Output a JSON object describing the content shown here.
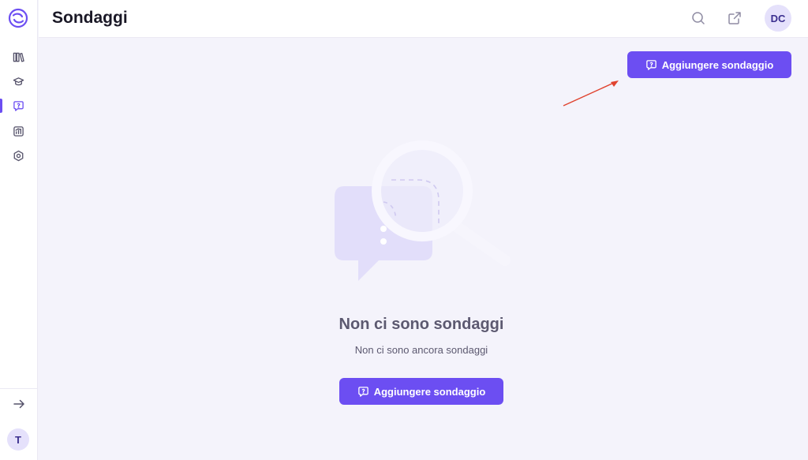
{
  "header": {
    "title": "Sondaggi",
    "avatar_initials": "DC"
  },
  "sidebar": {
    "items": [
      {
        "name": "library",
        "icon": "books-icon"
      },
      {
        "name": "courses",
        "icon": "graduation-cap-icon"
      },
      {
        "name": "surveys",
        "icon": "question-bubble-icon",
        "active": true
      },
      {
        "name": "analytics",
        "icon": "chart-icon"
      },
      {
        "name": "settings",
        "icon": "hexagon-gear-icon"
      }
    ],
    "user_initial": "T"
  },
  "actions": {
    "add_survey_label": "Aggiungere sondaggio"
  },
  "empty_state": {
    "title": "Non ci sono sondaggi",
    "subtitle": "Non ci sono ancora sondaggi",
    "button_label": "Aggiungere sondaggio"
  },
  "colors": {
    "accent": "#6c4ef2",
    "background": "#f4f3fb",
    "annotation_arrow": "#e0432f"
  }
}
